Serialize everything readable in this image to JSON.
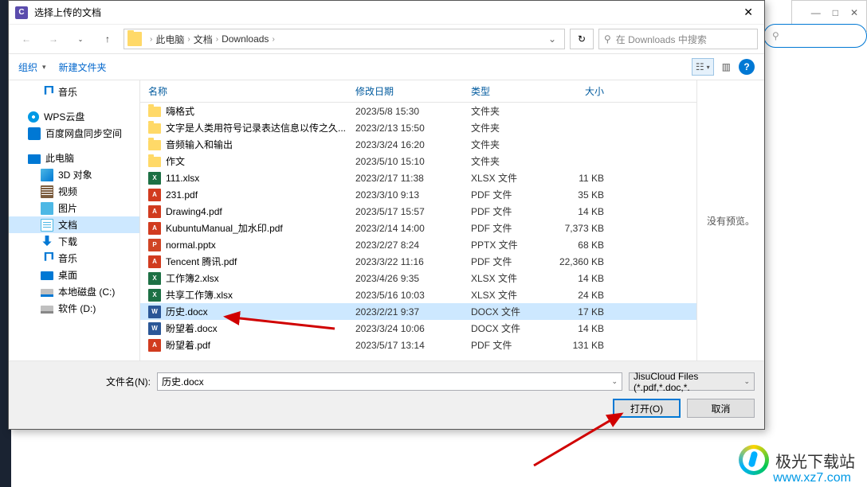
{
  "bg": {
    "search_icon": "⚲"
  },
  "dialog": {
    "title": "选择上传的文档",
    "close": "✕",
    "app_icon_letter": "C"
  },
  "nav": {
    "back": "←",
    "forward": "→",
    "up": "↑",
    "crumbs": [
      "此电脑",
      "文档",
      "Downloads"
    ],
    "sep": "›",
    "dropdown": "⌄",
    "refresh": "↻",
    "search_icon": "⚲",
    "search_placeholder": "在 Downloads 中搜索"
  },
  "toolbar": {
    "organize": "组织",
    "new_folder": "新建文件夹",
    "menu_arrow": "▾",
    "view_icon": "☷",
    "preview_icon": "▥",
    "help": "?"
  },
  "tree": {
    "items": [
      {
        "label": "音乐",
        "ico": "ico-music",
        "indent": 1
      },
      {
        "label": "WPS云盘",
        "ico": "ico-wps",
        "indent": 0,
        "gap": true
      },
      {
        "label": "百度网盘同步空间",
        "ico": "ico-baidu",
        "indent": 0
      },
      {
        "label": "此电脑",
        "ico": "ico-pc",
        "indent": 0,
        "gap": true
      },
      {
        "label": "3D 对象",
        "ico": "ico-3d",
        "indent": 1
      },
      {
        "label": "视频",
        "ico": "ico-video",
        "indent": 1
      },
      {
        "label": "图片",
        "ico": "ico-pic",
        "indent": 1
      },
      {
        "label": "文档",
        "ico": "ico-doc",
        "indent": 1,
        "selected": true
      },
      {
        "label": "下载",
        "ico": "ico-download",
        "indent": 1
      },
      {
        "label": "音乐",
        "ico": "ico-music",
        "indent": 1
      },
      {
        "label": "桌面",
        "ico": "ico-desktop",
        "indent": 1
      },
      {
        "label": "本地磁盘 (C:)",
        "ico": "ico-disk",
        "indent": 1
      },
      {
        "label": "软件 (D:)",
        "ico": "ico-disk ico-disk2",
        "indent": 1
      }
    ]
  },
  "columns": {
    "name": "名称",
    "date": "修改日期",
    "type": "类型",
    "size": "大小"
  },
  "files": [
    {
      "name": "嗨格式",
      "date": "2023/5/8 15:30",
      "type": "文件夹",
      "size": "",
      "ico": "fico-folder"
    },
    {
      "name": "文字是人类用符号记录表达信息以传之久...",
      "date": "2023/2/13 15:50",
      "type": "文件夹",
      "size": "",
      "ico": "fico-folder"
    },
    {
      "name": "音频输入和输出",
      "date": "2023/3/24 16:20",
      "type": "文件夹",
      "size": "",
      "ico": "fico-folder"
    },
    {
      "name": "作文",
      "date": "2023/5/10 15:10",
      "type": "文件夹",
      "size": "",
      "ico": "fico-folder"
    },
    {
      "name": "111.xlsx",
      "date": "2023/2/17 11:38",
      "type": "XLSX 文件",
      "size": "11 KB",
      "ico": "fico-xlsx",
      "letter": "X"
    },
    {
      "name": "231.pdf",
      "date": "2023/3/10 9:13",
      "type": "PDF 文件",
      "size": "35 KB",
      "ico": "fico-pdf",
      "letter": "A"
    },
    {
      "name": "Drawing4.pdf",
      "date": "2023/5/17 15:57",
      "type": "PDF 文件",
      "size": "14 KB",
      "ico": "fico-pdf",
      "letter": "A"
    },
    {
      "name": "KubuntuManual_加水印.pdf",
      "date": "2023/2/14 14:00",
      "type": "PDF 文件",
      "size": "7,373 KB",
      "ico": "fico-pdf",
      "letter": "A"
    },
    {
      "name": "normal.pptx",
      "date": "2023/2/27 8:24",
      "type": "PPTX 文件",
      "size": "68 KB",
      "ico": "fico-pptx",
      "letter": "P"
    },
    {
      "name": "Tencent 腾讯.pdf",
      "date": "2023/3/22 11:16",
      "type": "PDF 文件",
      "size": "22,360 KB",
      "ico": "fico-pdf",
      "letter": "A"
    },
    {
      "name": "工作簿2.xlsx",
      "date": "2023/4/26 9:35",
      "type": "XLSX 文件",
      "size": "14 KB",
      "ico": "fico-xlsx",
      "letter": "X"
    },
    {
      "name": "共享工作簿.xlsx",
      "date": "2023/5/16 10:03",
      "type": "XLSX 文件",
      "size": "24 KB",
      "ico": "fico-xlsx",
      "letter": "X"
    },
    {
      "name": "历史.docx",
      "date": "2023/2/21 9:37",
      "type": "DOCX 文件",
      "size": "17 KB",
      "ico": "fico-docx",
      "letter": "W",
      "selected": true
    },
    {
      "name": "盼望着.docx",
      "date": "2023/3/24 10:06",
      "type": "DOCX 文件",
      "size": "14 KB",
      "ico": "fico-docx",
      "letter": "W"
    },
    {
      "name": "盼望着.pdf",
      "date": "2023/5/17 13:14",
      "type": "PDF 文件",
      "size": "131 KB",
      "ico": "fico-pdf",
      "letter": "A"
    }
  ],
  "preview": {
    "text": "没有预览。"
  },
  "bottom": {
    "filename_label": "文件名(N):",
    "filename_value": "历史.docx",
    "filetype": "JisuCloud Files (*.pdf,*.doc,*.",
    "open": "打开(O)",
    "cancel": "取消",
    "dropdown": "⌄"
  },
  "logo": {
    "text": "极光下载站",
    "url": "www.xz7.com"
  }
}
